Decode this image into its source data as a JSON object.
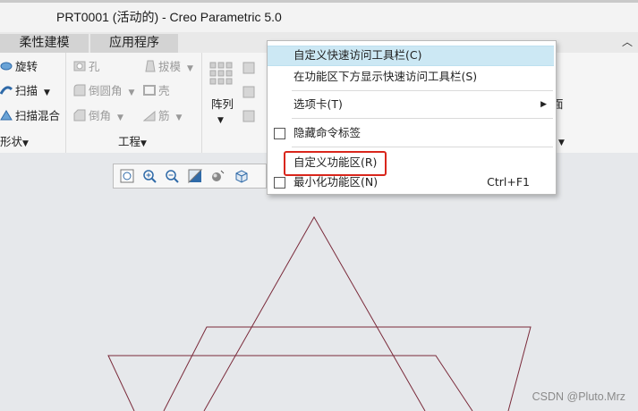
{
  "window": {
    "title": "PRT0001 (活动的) - Creo Parametric 5.0"
  },
  "tabs": [
    {
      "label": "柔性建模"
    },
    {
      "label": "应用程序"
    }
  ],
  "ribbon": {
    "shape_items": [
      "旋转",
      "扫描",
      "扫描混合"
    ],
    "engineering_items": [
      "孔",
      "倒圆角",
      "倒角",
      "拔模",
      "壳",
      "筋"
    ],
    "array_label": "阵列",
    "partial_right": "面",
    "groups": {
      "shape": "形状",
      "engineering": "工程"
    }
  },
  "context_menu": {
    "items": [
      {
        "label": "自定义快速访问工具栏(C)",
        "highlighted": true
      },
      {
        "label": "在功能区下方显示快速访问工具栏(S)"
      },
      {
        "label": "选项卡(T)",
        "submenu": true
      },
      {
        "label": "隐藏命令标签",
        "checkbox": true
      },
      {
        "label": "自定义功能区(R)",
        "emphasized": true
      },
      {
        "label": "最小化功能区(N)",
        "checkbox": true,
        "shortcut": "Ctrl+F1"
      }
    ]
  },
  "colors": {
    "highlight": "#cce8f4",
    "red_box": "#d9261c",
    "sketch": "#7a2a3a"
  },
  "watermark": "CSDN @Pluto.Mrz"
}
